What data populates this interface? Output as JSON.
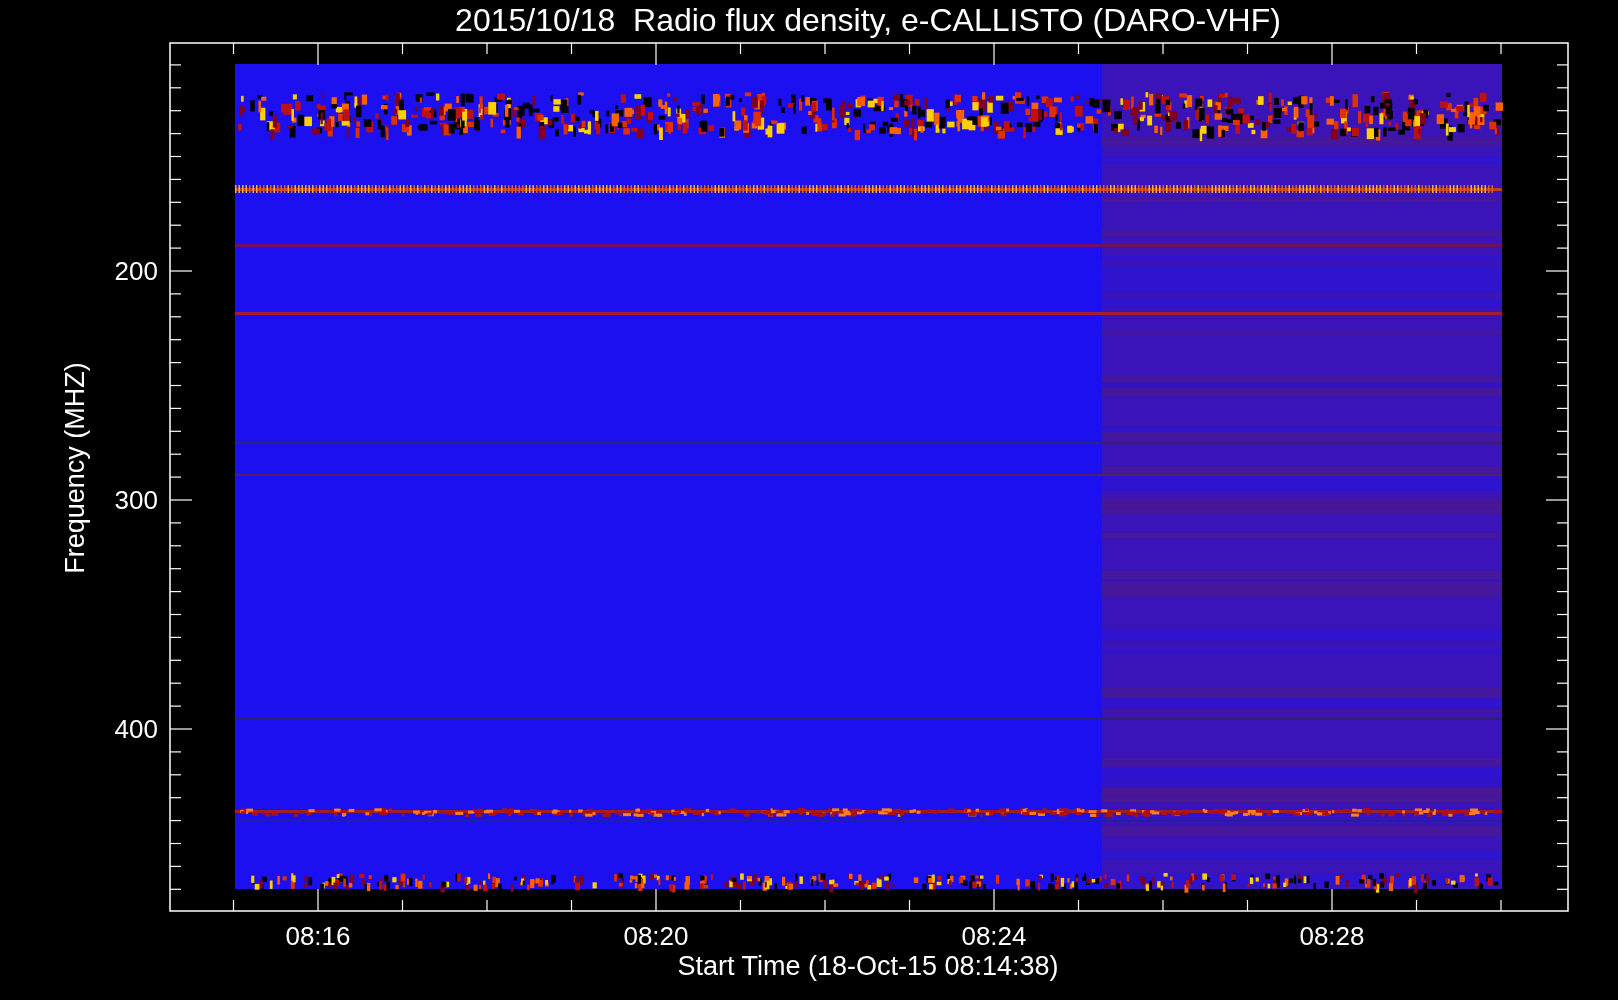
{
  "title": "2015/10/18  Radio flux density, e-CALLISTO (DARO-VHF)",
  "y_axis": {
    "label": "Frequency (MHZ)",
    "ticks": [
      "200",
      "300",
      "400"
    ]
  },
  "x_axis": {
    "label": "Start Time (18-Oct-15 08:14:38)",
    "ticks": [
      "08:16",
      "08:20",
      "08:24",
      "08:28"
    ]
  }
}
